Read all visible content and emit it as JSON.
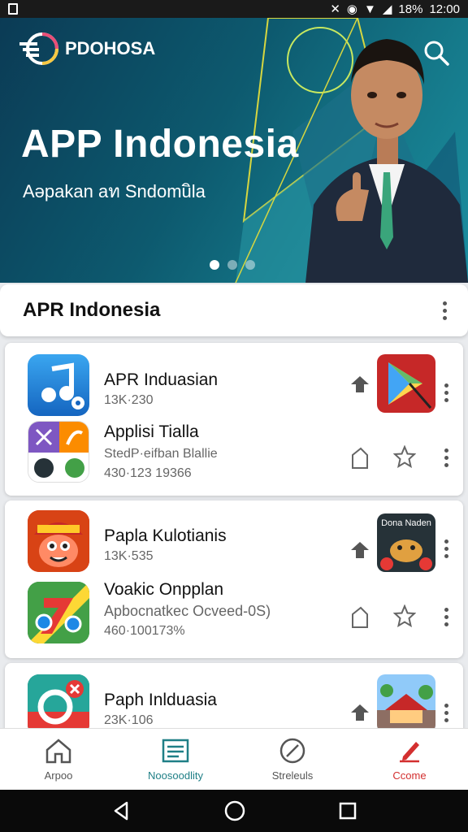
{
  "status_bar": {
    "battery": "18%",
    "time": "12:00"
  },
  "hero": {
    "brand": "PDOHOSA",
    "title": "APP Indonesia",
    "subtitle": "Aǝpakan aท Sndomuิla",
    "slides": 3,
    "active_slide": 1
  },
  "section": {
    "title": "APR Indonesia"
  },
  "apps": [
    {
      "name": "APR Induasian",
      "meta1": "13K·230",
      "meta2": ""
    },
    {
      "name": "Applisi Tialla",
      "meta1": "StedP·eifban Blallie",
      "meta2": "430·123 19366"
    },
    {
      "name": "Papla Kulotianis",
      "meta1": "13K·535",
      "meta2": ""
    },
    {
      "name": "Voakic Onpplan",
      "meta1": "Apbocnatkec Ocveed-0S)",
      "meta2": "460·100173%"
    },
    {
      "name": "Paph Inlduasia",
      "meta1": "23K·106",
      "meta2": ""
    }
  ],
  "thumb_labels": {
    "game": "Dona Naden"
  },
  "bottom_nav": [
    {
      "label": "Arpoo",
      "icon": "home-icon"
    },
    {
      "label": "Noosoodlity",
      "icon": "list-icon"
    },
    {
      "label": "Streleuls",
      "icon": "compass-icon"
    },
    {
      "label": "Ccome",
      "icon": "edit-icon"
    }
  ],
  "colors": {
    "accent": "#1f7f86",
    "hero_dark": "#0b3b55",
    "red": "#d32f2f"
  }
}
